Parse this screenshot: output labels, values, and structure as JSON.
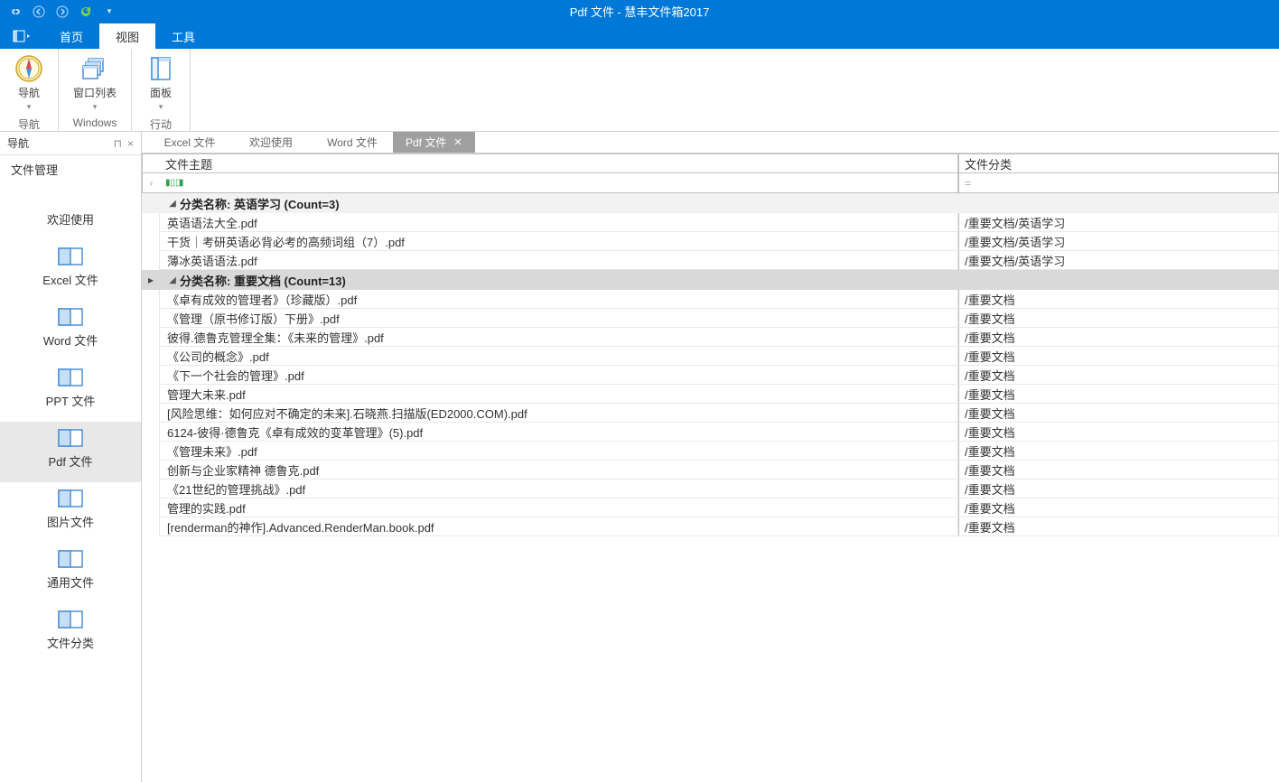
{
  "window": {
    "title": "Pdf 文件 - 慧丰文件箱2017"
  },
  "menu": {
    "tabs": [
      "首页",
      "视图",
      "工具"
    ],
    "active": 1
  },
  "ribbon": {
    "groups": [
      {
        "label": "导航",
        "btn": "导航"
      },
      {
        "label": "Windows",
        "btn": "窗口列表"
      },
      {
        "label": "行动",
        "btn": "面板"
      }
    ]
  },
  "sidebar": {
    "title": "导航",
    "section": "文件管理",
    "items": [
      {
        "label": "欢迎使用",
        "noicon": true
      },
      {
        "label": "Excel 文件"
      },
      {
        "label": "Word 文件"
      },
      {
        "label": "PPT 文件"
      },
      {
        "label": "Pdf 文件",
        "selected": true
      },
      {
        "label": "图片文件"
      },
      {
        "label": "通用文件"
      },
      {
        "label": "文件分类"
      }
    ]
  },
  "doctabs": [
    {
      "label": "Excel 文件"
    },
    {
      "label": "欢迎使用"
    },
    {
      "label": "Word 文件"
    },
    {
      "label": "Pdf 文件",
      "active": true
    }
  ],
  "grid": {
    "columns": {
      "topic": "文件主题",
      "category": "文件分类"
    },
    "groups": [
      {
        "title": "分类名称: 英语学习 (Count=3)",
        "rows": [
          {
            "topic": "英语语法大全.pdf",
            "cat": "/重要文档/英语学习"
          },
          {
            "topic": "干货｜考研英语必背必考的高频词组（7）.pdf",
            "cat": "/重要文档/英语学习"
          },
          {
            "topic": "薄冰英语语法.pdf",
            "cat": "/重要文档/英语学习"
          }
        ]
      },
      {
        "title": "分类名称: 重要文档 (Count=13)",
        "selected": true,
        "rows": [
          {
            "topic": "《卓有成效的管理者》（珍藏版）.pdf",
            "cat": "/重要文档"
          },
          {
            "topic": "《管理（原书修订版）下册》.pdf",
            "cat": "/重要文档"
          },
          {
            "topic": "彼得.德鲁克管理全集：《未来的管理》.pdf",
            "cat": "/重要文档"
          },
          {
            "topic": "《公司的概念》.pdf",
            "cat": "/重要文档"
          },
          {
            "topic": "《下一个社会的管理》.pdf",
            "cat": "/重要文档"
          },
          {
            "topic": "管理大未来.pdf",
            "cat": "/重要文档"
          },
          {
            "topic": "[风险思维：如何应对不确定的未来].石晓燕.扫描版(ED2000.COM).pdf",
            "cat": "/重要文档"
          },
          {
            "topic": "6124-彼得·德鲁克《卓有成效的变革管理》(5).pdf",
            "cat": "/重要文档"
          },
          {
            "topic": "《管理未来》.pdf",
            "cat": "/重要文档"
          },
          {
            "topic": "创新与企业家精神 德鲁克.pdf",
            "cat": "/重要文档"
          },
          {
            "topic": "《21世纪的管理挑战》.pdf",
            "cat": "/重要文档"
          },
          {
            "topic": "管理的实践.pdf",
            "cat": "/重要文档"
          },
          {
            "topic": "[renderman的神作].Advanced.RenderMan.book.pdf",
            "cat": "/重要文档"
          }
        ]
      }
    ]
  }
}
